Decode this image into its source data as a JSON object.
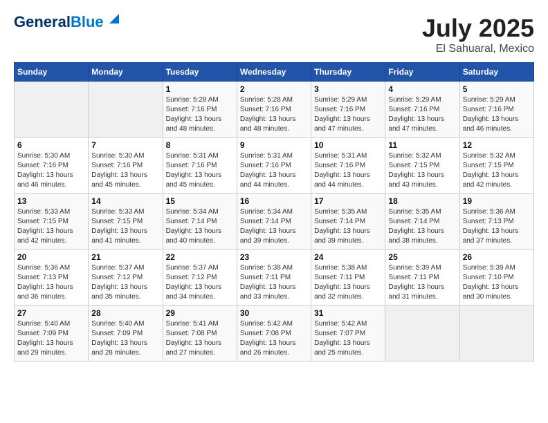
{
  "header": {
    "logo_line1": "General",
    "logo_line2": "Blue",
    "title": "July 2025",
    "subtitle": "El Sahuaral, Mexico"
  },
  "calendar": {
    "days_of_week": [
      "Sunday",
      "Monday",
      "Tuesday",
      "Wednesday",
      "Thursday",
      "Friday",
      "Saturday"
    ],
    "weeks": [
      [
        {
          "day": null
        },
        {
          "day": null
        },
        {
          "day": "1",
          "sunrise": "5:28 AM",
          "sunset": "7:16 PM",
          "daylight": "13 hours and 48 minutes."
        },
        {
          "day": "2",
          "sunrise": "5:28 AM",
          "sunset": "7:16 PM",
          "daylight": "13 hours and 48 minutes."
        },
        {
          "day": "3",
          "sunrise": "5:29 AM",
          "sunset": "7:16 PM",
          "daylight": "13 hours and 47 minutes."
        },
        {
          "day": "4",
          "sunrise": "5:29 AM",
          "sunset": "7:16 PM",
          "daylight": "13 hours and 47 minutes."
        },
        {
          "day": "5",
          "sunrise": "5:29 AM",
          "sunset": "7:16 PM",
          "daylight": "13 hours and 46 minutes."
        }
      ],
      [
        {
          "day": "6",
          "sunrise": "5:30 AM",
          "sunset": "7:16 PM",
          "daylight": "13 hours and 46 minutes."
        },
        {
          "day": "7",
          "sunrise": "5:30 AM",
          "sunset": "7:16 PM",
          "daylight": "13 hours and 45 minutes."
        },
        {
          "day": "8",
          "sunrise": "5:31 AM",
          "sunset": "7:16 PM",
          "daylight": "13 hours and 45 minutes."
        },
        {
          "day": "9",
          "sunrise": "5:31 AM",
          "sunset": "7:16 PM",
          "daylight": "13 hours and 44 minutes."
        },
        {
          "day": "10",
          "sunrise": "5:31 AM",
          "sunset": "7:16 PM",
          "daylight": "13 hours and 44 minutes."
        },
        {
          "day": "11",
          "sunrise": "5:32 AM",
          "sunset": "7:15 PM",
          "daylight": "13 hours and 43 minutes."
        },
        {
          "day": "12",
          "sunrise": "5:32 AM",
          "sunset": "7:15 PM",
          "daylight": "13 hours and 42 minutes."
        }
      ],
      [
        {
          "day": "13",
          "sunrise": "5:33 AM",
          "sunset": "7:15 PM",
          "daylight": "13 hours and 42 minutes."
        },
        {
          "day": "14",
          "sunrise": "5:33 AM",
          "sunset": "7:15 PM",
          "daylight": "13 hours and 41 minutes."
        },
        {
          "day": "15",
          "sunrise": "5:34 AM",
          "sunset": "7:14 PM",
          "daylight": "13 hours and 40 minutes."
        },
        {
          "day": "16",
          "sunrise": "5:34 AM",
          "sunset": "7:14 PM",
          "daylight": "13 hours and 39 minutes."
        },
        {
          "day": "17",
          "sunrise": "5:35 AM",
          "sunset": "7:14 PM",
          "daylight": "13 hours and 39 minutes."
        },
        {
          "day": "18",
          "sunrise": "5:35 AM",
          "sunset": "7:14 PM",
          "daylight": "13 hours and 38 minutes."
        },
        {
          "day": "19",
          "sunrise": "5:36 AM",
          "sunset": "7:13 PM",
          "daylight": "13 hours and 37 minutes."
        }
      ],
      [
        {
          "day": "20",
          "sunrise": "5:36 AM",
          "sunset": "7:13 PM",
          "daylight": "13 hours and 36 minutes."
        },
        {
          "day": "21",
          "sunrise": "5:37 AM",
          "sunset": "7:12 PM",
          "daylight": "13 hours and 35 minutes."
        },
        {
          "day": "22",
          "sunrise": "5:37 AM",
          "sunset": "7:12 PM",
          "daylight": "13 hours and 34 minutes."
        },
        {
          "day": "23",
          "sunrise": "5:38 AM",
          "sunset": "7:11 PM",
          "daylight": "13 hours and 33 minutes."
        },
        {
          "day": "24",
          "sunrise": "5:38 AM",
          "sunset": "7:11 PM",
          "daylight": "13 hours and 32 minutes."
        },
        {
          "day": "25",
          "sunrise": "5:39 AM",
          "sunset": "7:11 PM",
          "daylight": "13 hours and 31 minutes."
        },
        {
          "day": "26",
          "sunrise": "5:39 AM",
          "sunset": "7:10 PM",
          "daylight": "13 hours and 30 minutes."
        }
      ],
      [
        {
          "day": "27",
          "sunrise": "5:40 AM",
          "sunset": "7:09 PM",
          "daylight": "13 hours and 29 minutes."
        },
        {
          "day": "28",
          "sunrise": "5:40 AM",
          "sunset": "7:09 PM",
          "daylight": "13 hours and 28 minutes."
        },
        {
          "day": "29",
          "sunrise": "5:41 AM",
          "sunset": "7:08 PM",
          "daylight": "13 hours and 27 minutes."
        },
        {
          "day": "30",
          "sunrise": "5:42 AM",
          "sunset": "7:08 PM",
          "daylight": "13 hours and 26 minutes."
        },
        {
          "day": "31",
          "sunrise": "5:42 AM",
          "sunset": "7:07 PM",
          "daylight": "13 hours and 25 minutes."
        },
        {
          "day": null
        },
        {
          "day": null
        }
      ]
    ]
  }
}
